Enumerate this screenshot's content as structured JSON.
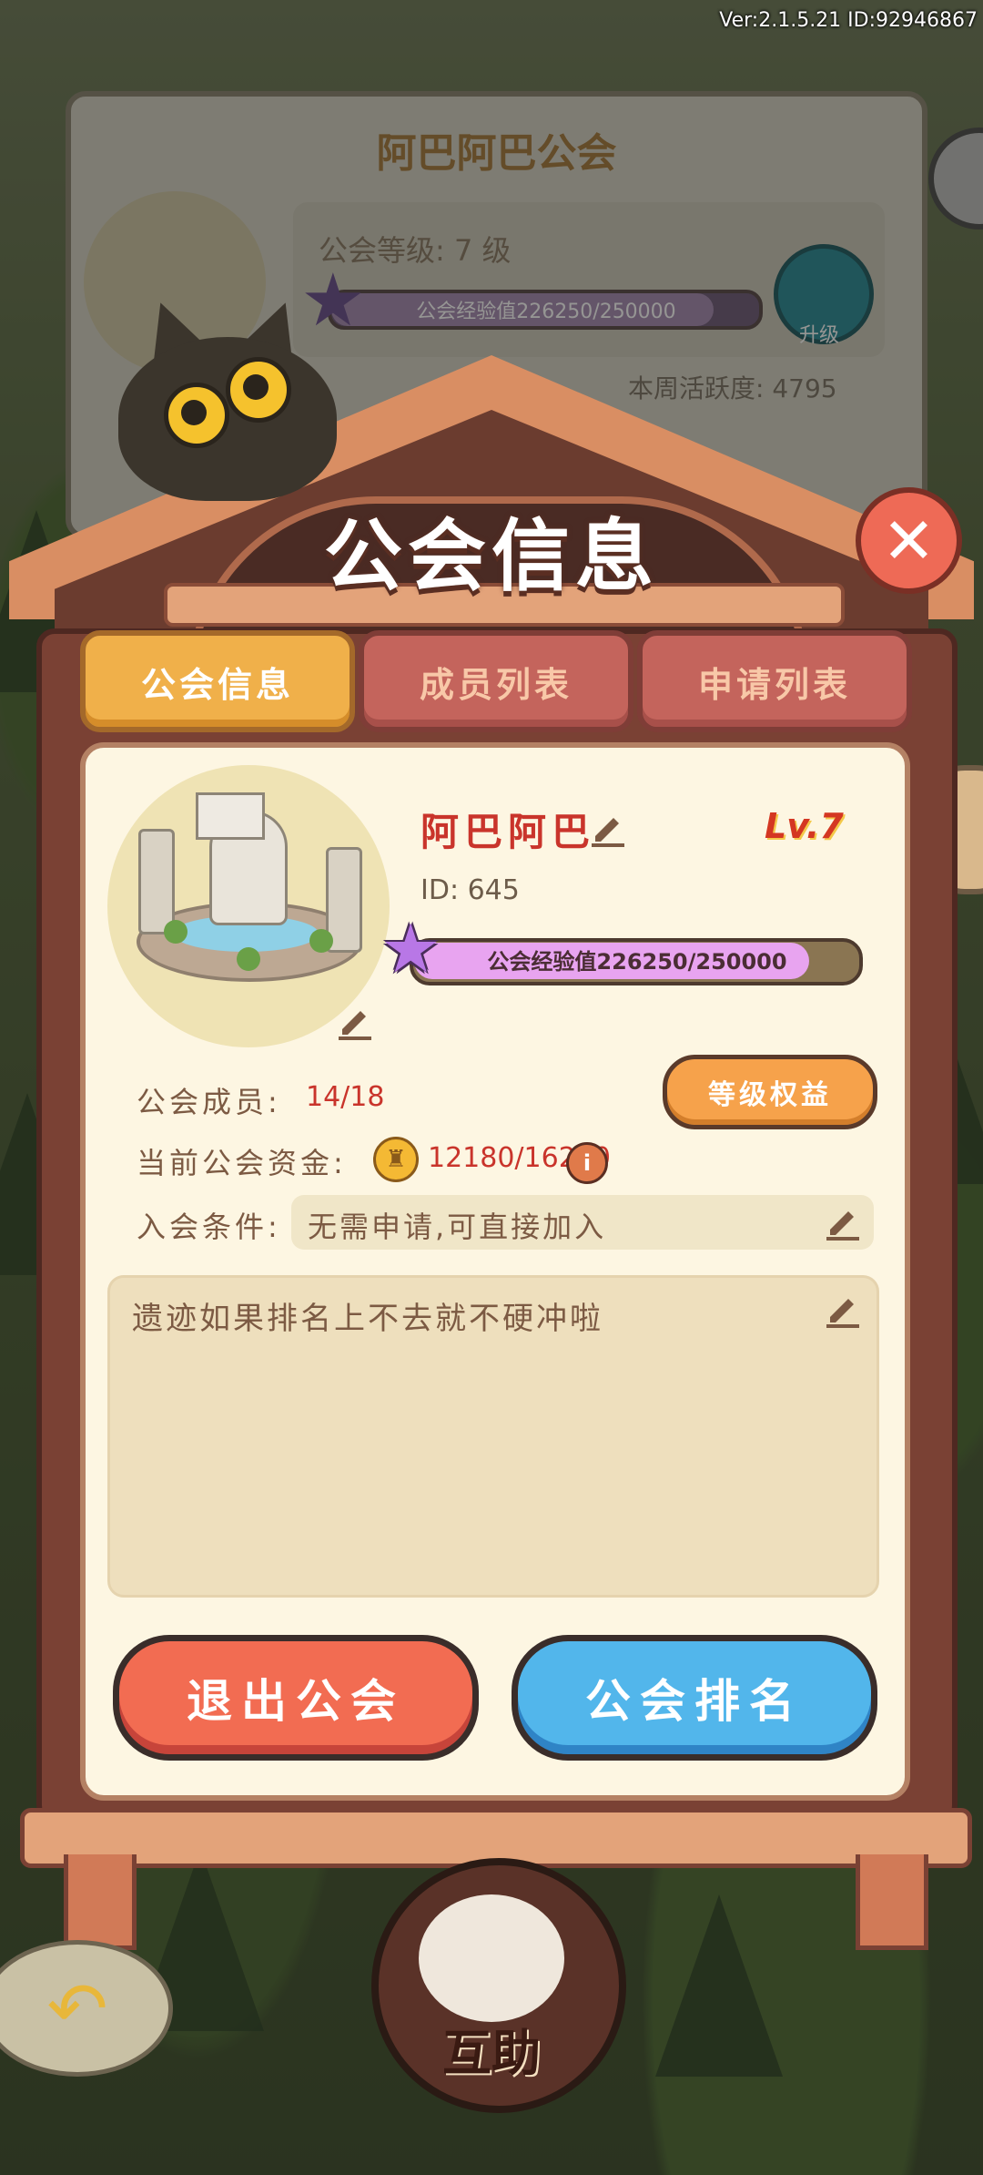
{
  "version_text": "Ver:2.1.5.21  ID:92946867",
  "background_panel": {
    "title": "阿巴阿巴公会",
    "level_text": "公会等级: 7 级",
    "exp_text": "公会经验值226250/250000",
    "upgrade_label": "升级",
    "weekly_activity": "本周活跃度: 4795"
  },
  "popup": {
    "title": "公会信息",
    "close_icon": "close-x-icon"
  },
  "tabs": [
    {
      "label": "公会信息",
      "active": true
    },
    {
      "label": "成员列表",
      "active": false
    },
    {
      "label": "申请列表",
      "active": false
    }
  ],
  "guild": {
    "name": "阿巴阿巴",
    "level_badge": "Lv.7",
    "id_text": "ID: 645",
    "exp_text": "公会经验值226250/250000",
    "exp_current": 226250,
    "exp_max": 250000,
    "members_label": "公会成员:",
    "members_value": "14/18",
    "benefit_button": "等级权益",
    "funds_label": "当前公会资金:",
    "funds_value": "12180/16200",
    "condition_label": "入会条件:",
    "condition_value": "无需申请,可直接加入",
    "notice": "遗迹如果排名上不去就不硬冲啦"
  },
  "buttons": {
    "exit": "退出公会",
    "rank": "公会排名"
  },
  "bottom": {
    "help_label": "互助"
  },
  "colors": {
    "tab_active": "#f0b04a",
    "tab_inactive": "#c4645c",
    "exit_button": "#f26c52",
    "rank_button": "#52b6eb",
    "name_red": "#c9342b",
    "exp_fill": "#e8a4f0"
  }
}
